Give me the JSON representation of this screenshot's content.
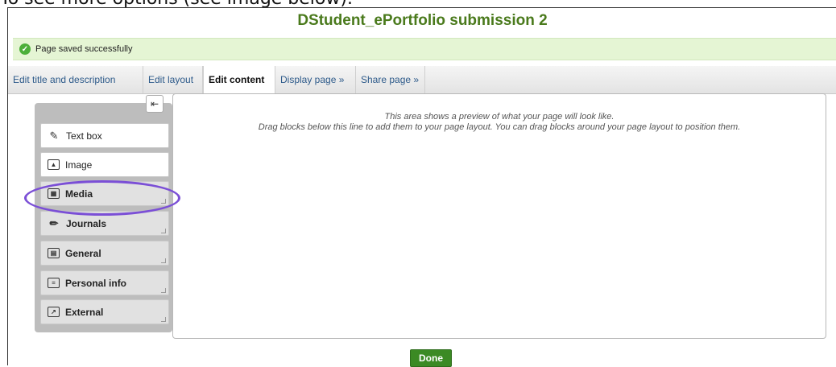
{
  "caption": "To see more options (see image below).",
  "page": {
    "title": "DStudent_ePortfolio submission 2",
    "notice": "Page saved successfully"
  },
  "tabs": [
    {
      "label": "Edit title and description",
      "active": false
    },
    {
      "label": "Edit layout",
      "active": false
    },
    {
      "label": "Edit content",
      "active": true
    },
    {
      "label": "Display page »",
      "active": false
    },
    {
      "label": "Share page »",
      "active": false
    }
  ],
  "blocks": [
    {
      "label": "Text box",
      "icon": "text-box-icon"
    },
    {
      "label": "Image",
      "icon": "image-icon"
    },
    {
      "label": "Media",
      "icon": "media-icon"
    },
    {
      "label": "Journals",
      "icon": "pencil-icon"
    },
    {
      "label": "General",
      "icon": "general-icon"
    },
    {
      "label": "Personal info",
      "icon": "id-card-icon"
    },
    {
      "label": "External",
      "icon": "external-icon"
    }
  ],
  "preview": {
    "line1": "This area shows a preview of what your page will look like.",
    "line2": "Drag blocks below this line to add them to your page layout. You can drag blocks around your page layout to position them."
  },
  "done_label": "Done",
  "colors": {
    "title": "#4a7a1c",
    "highlight": "#7b4fd6",
    "done": "#3b8a24"
  }
}
